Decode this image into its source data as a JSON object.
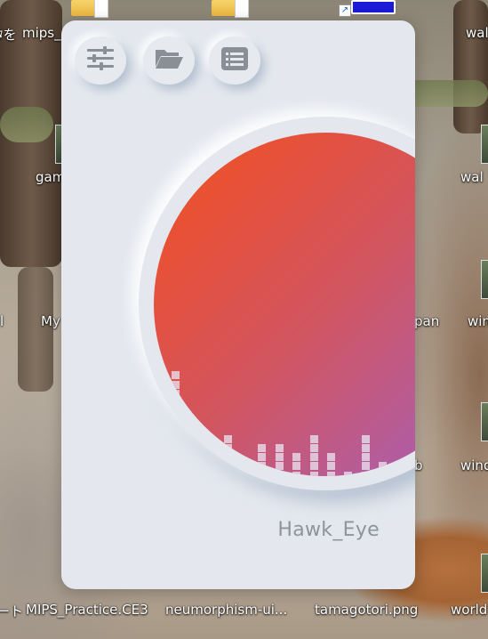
{
  "desktop": {
    "labels": {
      "top_left": "mips_",
      "top_left_prefix": "ﾀを",
      "top_right": "wal",
      "games": "gam",
      "wallpapers": "wal",
      "my": "My",
      "left_edge": "l",
      "right_mid": "pan",
      "win_right": "win",
      "win_right2": "wind",
      "bottom_left_prefix": "ート",
      "mips_practice": "MIPS_Practice.CE3",
      "neumorphism": "neumorphism-ui...",
      "tamagotori": "tamagotori.png",
      "world": "world",
      "b_mark": "b"
    }
  },
  "app": {
    "buttons": [
      {
        "name": "equalizer",
        "icon": "sliders-icon"
      },
      {
        "name": "open-folder",
        "icon": "folder-open-icon"
      },
      {
        "name": "playlist",
        "icon": "list-icon"
      }
    ],
    "artist_name": "Hawk_Eye",
    "colors": {
      "background": "#e4e8ee",
      "gradient_start": "#f1521d",
      "gradient_end": "#a05ec0",
      "icon": "#8a8f96",
      "artist_text": "#8e949c"
    },
    "visualizer": {
      "bar_heights": [
        13,
        13,
        0,
        0,
        6,
        3,
        5,
        5,
        4,
        6,
        4,
        2,
        6,
        3,
        3,
        2
      ]
    }
  }
}
